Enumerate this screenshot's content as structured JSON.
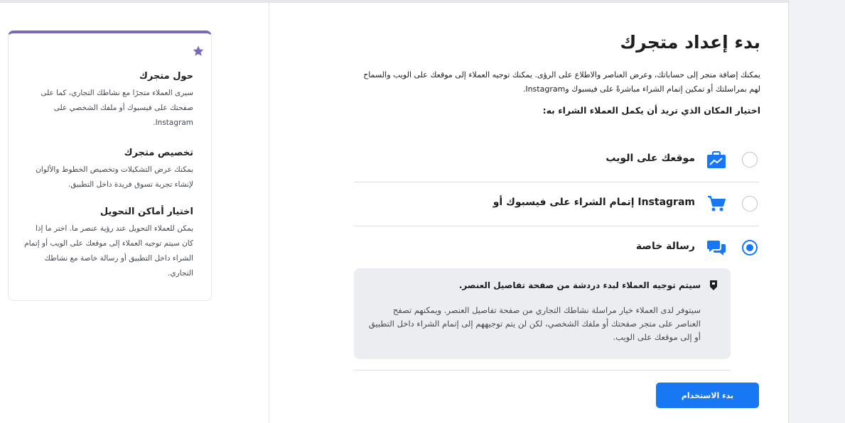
{
  "main": {
    "title": "بدء إعداد متجرك",
    "description": "يمكنك إضافة متجر إلى حساباتك، وعرض العناصر والاطلاع على الرؤى. يمكنك توجيه العملاء إلى موقعك على الويب والسماح لهم بمراسلتك أو تمكين إتمام الشراء مباشرةً على فيسبوك وInstagram.",
    "question": "اختيار المكان الذي تريد أن يكمل العملاء الشراء به:",
    "options": [
      {
        "label": "موقعك على الويب",
        "icon": "briefcase-icon",
        "selected": false
      },
      {
        "label": "إتمام الشراء على فيسبوك أو Instagram",
        "icon": "cart-icon",
        "selected": false
      },
      {
        "label": "رسالة خاصة",
        "icon": "messages-icon",
        "selected": true
      }
    ],
    "info": {
      "title": "سيتم توجيه العملاء لبدء دردشة من صفحة تفاصيل العنصر.",
      "body": "سيتوفر لدى العملاء خيار مراسلة نشاطك التجاري من صفحة تفاصيل العنصر. ويمكنهم تصفح العناصر على متجر صفحتك أو ملفك الشخصي، لكن لن يتم توجيههم إلى إتمام الشراء داخل التطبيق أو إلى موقعك على الويب."
    },
    "start_button": "بدء الاستخدام"
  },
  "sidebar": {
    "sections": [
      {
        "title": "حول متجرك",
        "body": "سيرى العملاء متجرًا مع نشاطك التجاري، كما على صفحتك على فيسبوك أو ملفك الشخصي على Instagram."
      },
      {
        "title": "تخصيص متجرك",
        "body": "يمكنك عرض التشكيلات وتخصيص الخطوط والألوان لإنشاء تجربة تسوق فريدة داخل التطبيق."
      },
      {
        "title": "اختيار أماكن التحويل",
        "body": "يمكن للعملاء التحويل عند رؤية عنصر ما. اختر ما إذا كان سيتم توجيه العملاء إلى موقعك على الويب أو إتمام الشراء داخل التطبيق أو رسالة خاصة مع نشاطك التجاري."
      }
    ]
  },
  "colors": {
    "accent": "#1877f2",
    "card_border": "#7b68b7",
    "info_bg": "#ebedf0"
  }
}
